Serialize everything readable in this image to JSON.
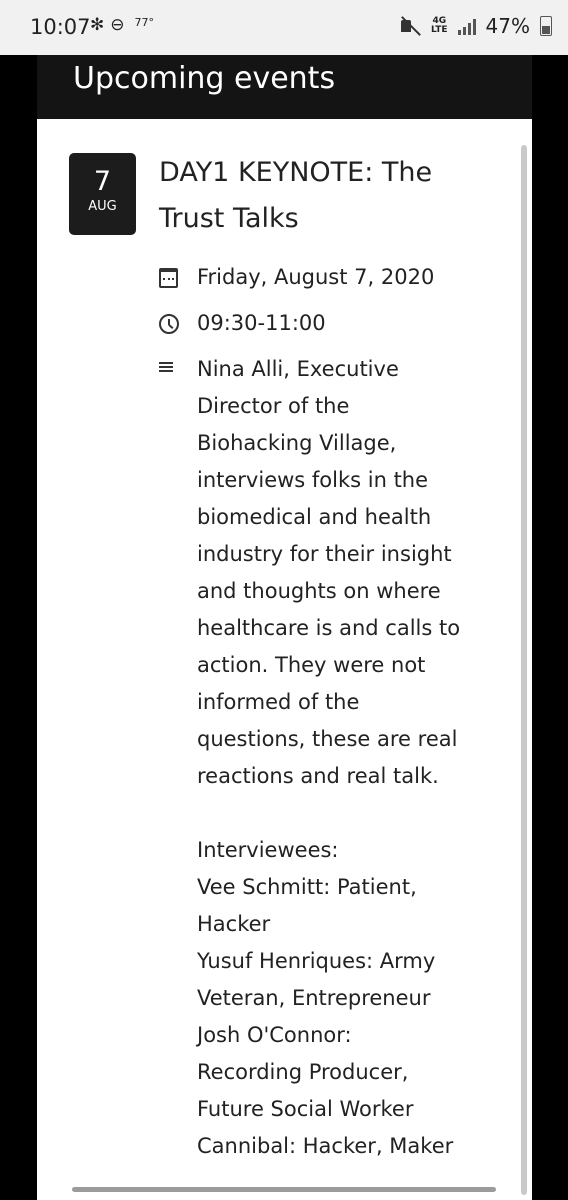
{
  "status_bar": {
    "time": "10:07",
    "temp": "77°",
    "network": "4G",
    "network_sub": "LTE",
    "battery": "47%"
  },
  "header": {
    "title": "Upcoming events"
  },
  "event": {
    "day": "7",
    "month": "AUG",
    "title": "DAY1 KEYNOTE: The Trust Talks",
    "date": "Friday, August 7, 2020",
    "time": "09:30-11:00",
    "description": "Nina Alli, Executive\nDirector of the\nBiohacking Village,\ninterviews folks in the\nbiomedical and health\nindustry for their insight\nand thoughts on where\nhealthcare is and calls to\naction. They were not\ninformed of the\nquestions, these are real\nreactions and real talk.\n\nInterviewees:\nVee Schmitt: Patient,\nHacker\nYusuf Henriques: Army\nVeteran, Entrepreneur\nJosh O'Connor:\nRecording Producer,\nFuture Social Worker\nCannibal: Hacker, Maker"
  },
  "icons": {
    "date": "calendar-icon",
    "time": "clock-icon",
    "description": "notes-icon"
  }
}
